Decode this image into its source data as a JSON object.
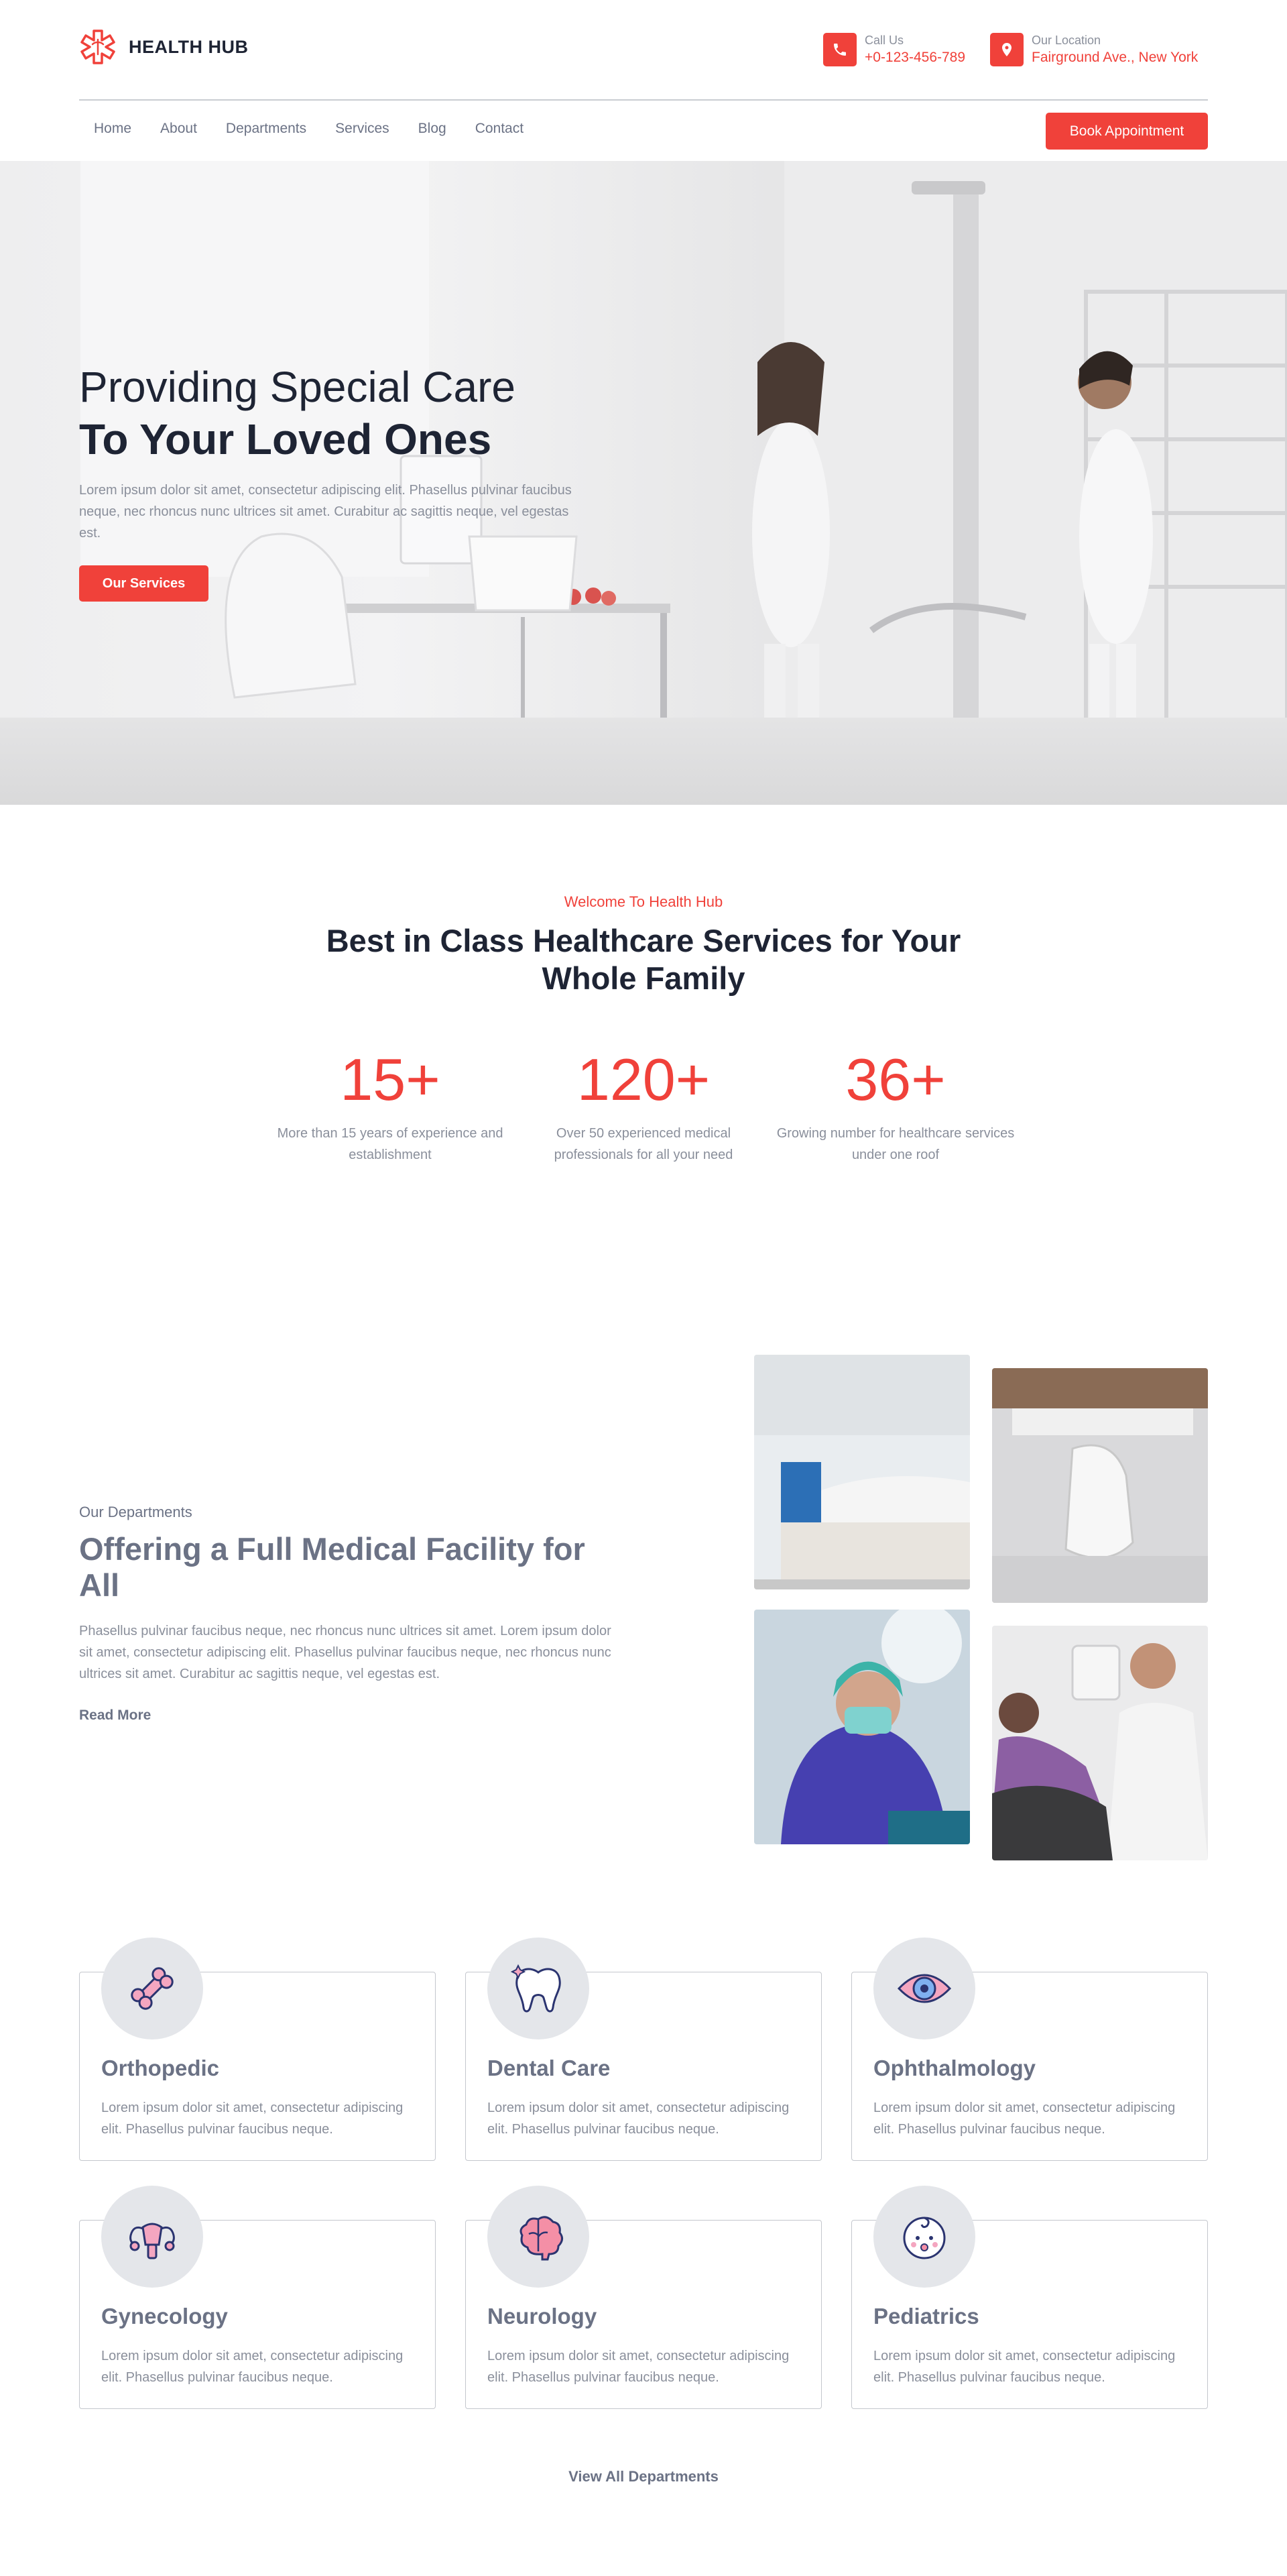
{
  "brand": {
    "name": "HEALTH HUB",
    "accent": "#f0413a"
  },
  "contact": {
    "call_label": "Call Us",
    "call_value": "+0-123-456-789",
    "location_label": "Our Location",
    "location_value": "Fairground Ave., New York"
  },
  "nav": {
    "items": [
      "Home",
      "About",
      "Departments",
      "Services",
      "Blog",
      "Contact"
    ],
    "cta": "Book Appointment"
  },
  "hero": {
    "title_line1": "Providing Special Care",
    "title_line2": "To Your Loved Ones",
    "description": "Lorem ipsum dolor sit amet, consectetur adipiscing elit. Phasellus pulvinar faucibus neque, nec rhoncus nunc ultrices sit amet. Curabitur ac sagittis neque, vel egestas est.",
    "button": "Our Services"
  },
  "welcome": {
    "kicker": "Welcome To Health Hub",
    "title": "Best in Class Healthcare Services for Your Whole Family",
    "stats": [
      {
        "number": "15+",
        "caption": "More than 15 years of experience and establishment"
      },
      {
        "number": "120+",
        "caption": "Over 50 experienced medical professionals for all your need"
      },
      {
        "number": "36+",
        "caption": "Growing number for healthcare services under one roof"
      }
    ]
  },
  "departments_intro": {
    "kicker": "Our Departments",
    "title": "Offering a Full Medical Facility for All",
    "description": "Phasellus pulvinar faucibus neque, nec rhoncus nunc ultrices sit amet. Lorem ipsum dolor sit amet, consectetur adipiscing elit. Phasellus pulvinar faucibus neque, nec rhoncus nunc ultrices sit amet. Curabitur ac sagittis neque, vel egestas est.",
    "link": "Read More"
  },
  "departments": [
    {
      "name": "Orthopedic",
      "icon": "bone-icon",
      "description": "Lorem ipsum dolor sit amet, consectetur adipiscing elit. Phasellus pulvinar faucibus neque."
    },
    {
      "name": "Dental Care",
      "icon": "tooth-icon",
      "description": "Lorem ipsum dolor sit amet, consectetur adipiscing elit. Phasellus pulvinar faucibus neque."
    },
    {
      "name": "Ophthalmology",
      "icon": "eye-icon",
      "description": "Lorem ipsum dolor sit amet, consectetur adipiscing elit. Phasellus pulvinar faucibus neque."
    },
    {
      "name": "Gynecology",
      "icon": "uterus-icon",
      "description": "Lorem ipsum dolor sit amet, consectetur adipiscing elit. Phasellus pulvinar faucibus neque."
    },
    {
      "name": "Neurology",
      "icon": "brain-icon",
      "description": "Lorem ipsum dolor sit amet, consectetur adipiscing elit. Phasellus pulvinar faucibus neque."
    },
    {
      "name": "Pediatrics",
      "icon": "baby-icon",
      "description": "Lorem ipsum dolor sit amet, consectetur adipiscing elit. Phasellus pulvinar faucibus neque."
    }
  ],
  "view_all": "View All Departments"
}
